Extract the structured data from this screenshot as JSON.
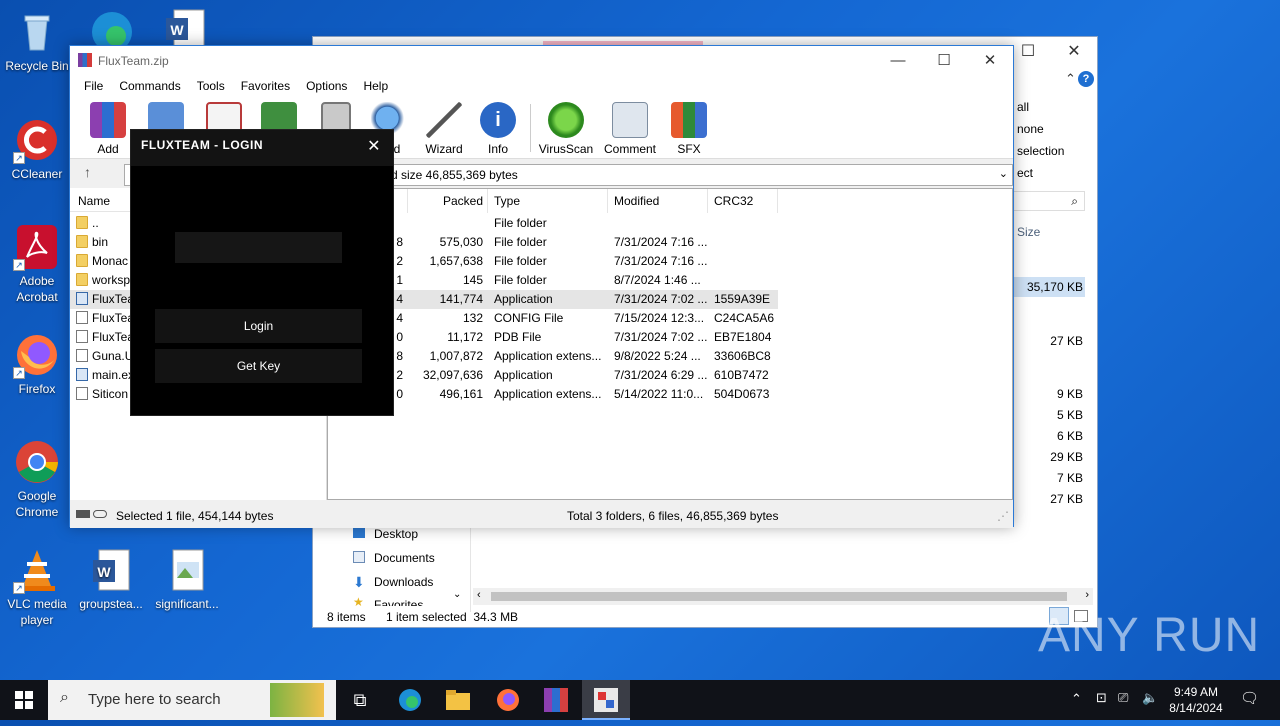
{
  "desktop": {
    "icons": [
      {
        "label": "Recycle Bin"
      },
      {
        "label": "CCleaner"
      },
      {
        "label": "Adobe Acrobat"
      },
      {
        "label": "Firefox"
      },
      {
        "label": "Google Chrome"
      },
      {
        "label": "VLC media player"
      },
      {
        "label": "groupstea..."
      },
      {
        "label": "significant..."
      }
    ]
  },
  "explorer": {
    "right_items": [
      "all",
      "none",
      "selection",
      "ect"
    ],
    "size_header": "Size",
    "sizes": [
      "35,170 KB",
      "27 KB",
      "9 KB",
      "5 KB",
      "6 KB",
      "29 KB",
      "7 KB",
      "27 KB"
    ],
    "nav": [
      "Desktop",
      "Documents",
      "Downloads",
      "Favorites"
    ],
    "status_count": "8 items",
    "status_selected": "1 item selected  34.3 MB"
  },
  "winrar": {
    "title": "FluxTeam.zip",
    "menu": [
      "File",
      "Commands",
      "Tools",
      "Favorites",
      "Options",
      "Help"
    ],
    "toolbar": [
      "Add",
      "",
      "",
      "",
      "",
      "d",
      "Wizard",
      "Info",
      "VirusScan",
      "Comment",
      "SFX"
    ],
    "address": "d size 46,855,369 bytes",
    "columns": {
      "name": "Name",
      "size": "te",
      "packed": "Packed",
      "type": "Type",
      "modified": "Modified",
      "crc": "CRC32"
    },
    "files": [
      {
        "name": "..",
        "size": "",
        "packed": "",
        "type": "File folder",
        "modified": "",
        "crc": "",
        "icon": "folder"
      },
      {
        "name": "bin",
        "size": "8",
        "packed": "575,030",
        "type": "File folder",
        "modified": "7/31/2024 7:16 ...",
        "crc": "",
        "icon": "folder"
      },
      {
        "name": "Monac",
        "size": "2",
        "packed": "1,657,638",
        "type": "File folder",
        "modified": "7/31/2024 7:16 ...",
        "crc": "",
        "icon": "folder"
      },
      {
        "name": "worksp",
        "size": "1",
        "packed": "145",
        "type": "File folder",
        "modified": "8/7/2024 1:46 ...",
        "crc": "",
        "icon": "folder"
      },
      {
        "name": "FluxTea",
        "size": "4",
        "packed": "141,774",
        "type": "Application",
        "modified": "7/31/2024 7:02 ...",
        "crc": "1559A39E",
        "icon": "app"
      },
      {
        "name": "FluxTea",
        "size": "4",
        "packed": "132",
        "type": "CONFIG File",
        "modified": "7/15/2024 12:3...",
        "crc": "C24CA5A6",
        "icon": "doc"
      },
      {
        "name": "FluxTea",
        "size": "0",
        "packed": "11,172",
        "type": "PDB File",
        "modified": "7/31/2024 7:02 ...",
        "crc": "EB7E1804",
        "icon": "doc"
      },
      {
        "name": "Guna.U",
        "size": "8",
        "packed": "1,007,872",
        "type": "Application extens...",
        "modified": "9/8/2022 5:24 ...",
        "crc": "33606BC8",
        "icon": "doc"
      },
      {
        "name": "main.ex",
        "size": "2",
        "packed": "32,097,636",
        "type": "Application",
        "modified": "7/31/2024 6:29 ...",
        "crc": "610B7472",
        "icon": "app"
      },
      {
        "name": "Siticon",
        "size": "0",
        "packed": "496,161",
        "type": "Application extens...",
        "modified": "5/14/2022 11:0...",
        "crc": "504D0673",
        "icon": "doc"
      }
    ],
    "status_left": "Selected 1 file, 454,144 bytes",
    "status_right": "Total 3 folders, 6 files, 46,855,369 bytes"
  },
  "login": {
    "title": "FLUXTEAM - LOGIN",
    "key_value": "",
    "login_label": "Login",
    "getkey_label": "Get Key"
  },
  "taskbar": {
    "search_placeholder": "Type here to search",
    "time": "9:49 AM",
    "date": "8/14/2024"
  },
  "watermark": "ANY RUN"
}
